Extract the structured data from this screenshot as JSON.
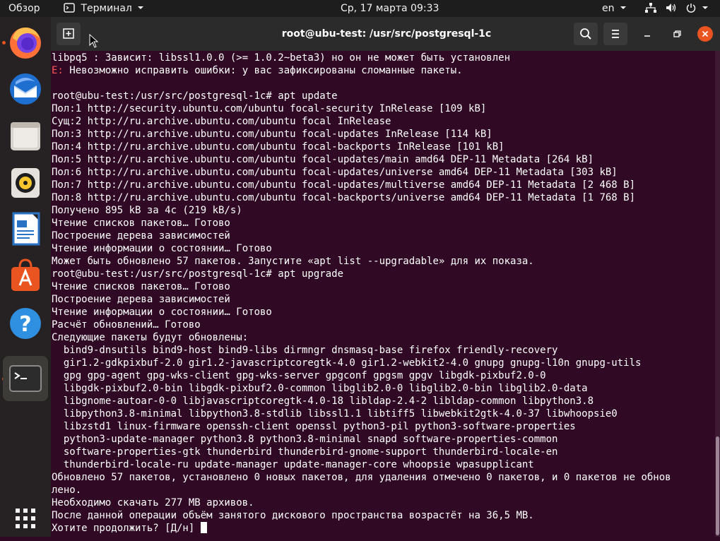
{
  "topbar": {
    "activities": "Обзор",
    "app_name": "Терминал",
    "clock": "Ср, 17 марта  09:33",
    "lang": "en"
  },
  "dock": {
    "items": [
      {
        "name": "firefox"
      },
      {
        "name": "thunderbird"
      },
      {
        "name": "files"
      },
      {
        "name": "rhythmbox"
      },
      {
        "name": "libreoffice-writer"
      },
      {
        "name": "software-center"
      },
      {
        "name": "help"
      },
      {
        "name": "terminal"
      },
      {
        "name": "show-applications"
      }
    ]
  },
  "window": {
    "title": "root@ubu-test: /usr/src/postgresql-1c"
  },
  "colors": {
    "terminal_bg": "#300a24",
    "error": "#ff5555",
    "accent": "#e95420"
  },
  "terminal": {
    "lines": [
      {
        "prefix": "",
        "text": "libpq5 : Зависит: libssl1.0.0 (>= 1.0.2~beta3) но он не может быть установлен"
      },
      {
        "prefix": "E:",
        "text": " Невозможно исправить ошибки: у вас зафиксированы сломанные пакеты."
      },
      {
        "prefix": "",
        "text": ""
      },
      {
        "prefix": "",
        "text": "root@ubu-test:/usr/src/postgresql-1c# apt update"
      },
      {
        "prefix": "",
        "text": "Пол:1 http://security.ubuntu.com/ubuntu focal-security InRelease [109 kB]"
      },
      {
        "prefix": "",
        "text": "Сущ:2 http://ru.archive.ubuntu.com/ubuntu focal InRelease"
      },
      {
        "prefix": "",
        "text": "Пол:3 http://ru.archive.ubuntu.com/ubuntu focal-updates InRelease [114 kB]"
      },
      {
        "prefix": "",
        "text": "Пол:4 http://ru.archive.ubuntu.com/ubuntu focal-backports InRelease [101 kB]"
      },
      {
        "prefix": "",
        "text": "Пол:5 http://ru.archive.ubuntu.com/ubuntu focal-updates/main amd64 DEP-11 Metadata [264 kB]"
      },
      {
        "prefix": "",
        "text": "Пол:6 http://ru.archive.ubuntu.com/ubuntu focal-updates/universe amd64 DEP-11 Metadata [303 kB]"
      },
      {
        "prefix": "",
        "text": "Пол:7 http://ru.archive.ubuntu.com/ubuntu focal-updates/multiverse amd64 DEP-11 Metadata [2 468 B]"
      },
      {
        "prefix": "",
        "text": "Пол:8 http://ru.archive.ubuntu.com/ubuntu focal-backports/universe amd64 DEP-11 Metadata [1 768 B]"
      },
      {
        "prefix": "",
        "text": "Получено 895 kB за 4с (219 kB/s)"
      },
      {
        "prefix": "",
        "text": "Чтение списков пакетов… Готово"
      },
      {
        "prefix": "",
        "text": "Построение дерева зависимостей"
      },
      {
        "prefix": "",
        "text": "Чтение информации о состоянии… Готово"
      },
      {
        "prefix": "",
        "text": "Может быть обновлено 57 пакетов. Запустите «apt list --upgradable» для их показа."
      },
      {
        "prefix": "",
        "text": "root@ubu-test:/usr/src/postgresql-1c# apt upgrade"
      },
      {
        "prefix": "",
        "text": "Чтение списков пакетов… Готово"
      },
      {
        "prefix": "",
        "text": "Построение дерева зависимостей"
      },
      {
        "prefix": "",
        "text": "Чтение информации о состоянии… Готово"
      },
      {
        "prefix": "",
        "text": "Расчёт обновлений… Готово"
      },
      {
        "prefix": "",
        "text": "Следующие пакеты будут обновлены:"
      },
      {
        "prefix": "",
        "text": "  bind9-dnsutils bind9-host bind9-libs dirmngr dnsmasq-base firefox friendly-recovery"
      },
      {
        "prefix": "",
        "text": "  gir1.2-gdkpixbuf-2.0 gir1.2-javascriptcoregtk-4.0 gir1.2-webkit2-4.0 gnupg gnupg-l10n gnupg-utils"
      },
      {
        "prefix": "",
        "text": "  gpg gpg-agent gpg-wks-client gpg-wks-server gpgconf gpgsm gpgv libgdk-pixbuf2.0-0"
      },
      {
        "prefix": "",
        "text": "  libgdk-pixbuf2.0-bin libgdk-pixbuf2.0-common libglib2.0-0 libglib2.0-bin libglib2.0-data"
      },
      {
        "prefix": "",
        "text": "  libgnome-autoar-0-0 libjavascriptcoregtk-4.0-18 libldap-2.4-2 libldap-common libpython3.8"
      },
      {
        "prefix": "",
        "text": "  libpython3.8-minimal libpython3.8-stdlib libssl1.1 libtiff5 libwebkit2gtk-4.0-37 libwhoopsie0"
      },
      {
        "prefix": "",
        "text": "  libzstd1 linux-firmware openssh-client openssl python3-pil python3-software-properties"
      },
      {
        "prefix": "",
        "text": "  python3-update-manager python3.8 python3.8-minimal snapd software-properties-common"
      },
      {
        "prefix": "",
        "text": "  software-properties-gtk thunderbird thunderbird-gnome-support thunderbird-locale-en"
      },
      {
        "prefix": "",
        "text": "  thunderbird-locale-ru update-manager update-manager-core whoopsie wpasupplicant"
      },
      {
        "prefix": "",
        "text": "Обновлено 57 пакетов, установлено 0 новых пакетов, для удаления отмечено 0 пакетов, и 0 пакетов не обнов"
      },
      {
        "prefix": "",
        "text": "лено."
      },
      {
        "prefix": "",
        "text": "Необходимо скачать 277 MB архивов."
      },
      {
        "prefix": "",
        "text": "После данной операции объём занятого дискового пространства возрастёт на 36,5 MB."
      },
      {
        "prefix": "",
        "text": "Хотите продолжить? [Д/н] "
      }
    ]
  }
}
